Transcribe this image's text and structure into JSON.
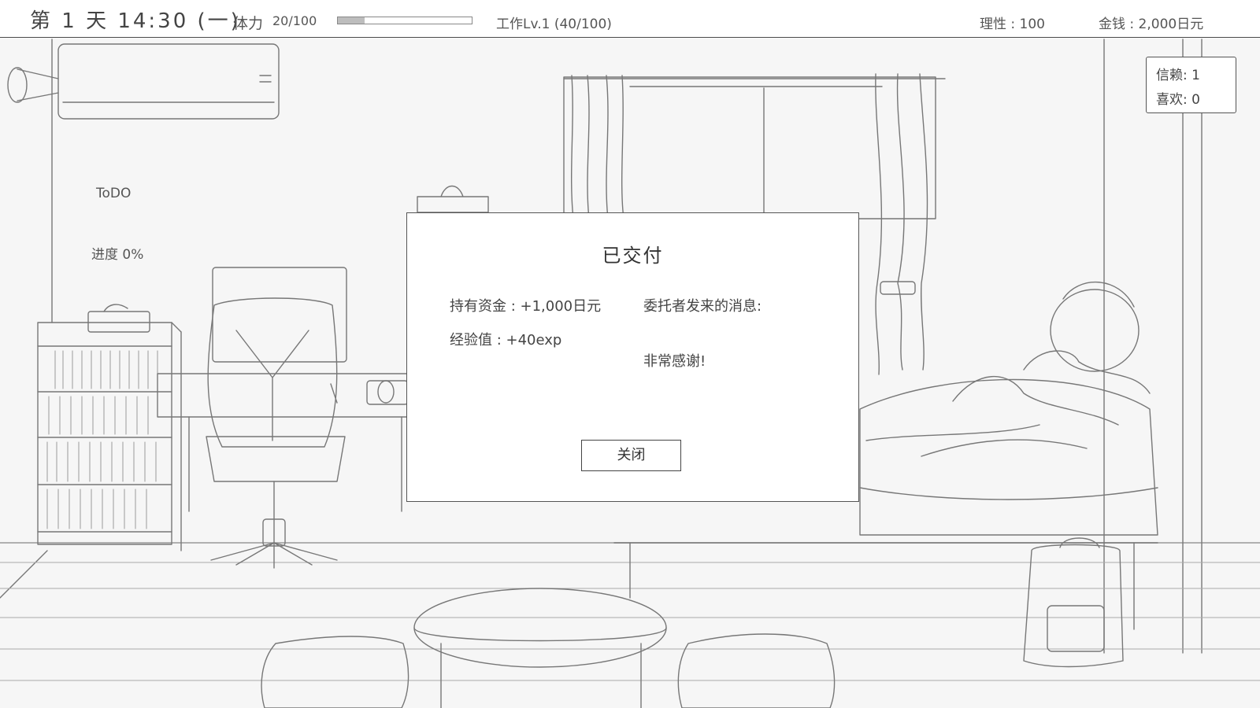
{
  "hud": {
    "day": "第 1 天 14:30 (一)",
    "stamina_label": "体力",
    "stamina_value": "20/100",
    "stamina_fraction": 0.2,
    "work": "工作Lv.1 (40/100)",
    "sanity": "理性 : 100",
    "money": "金钱 : 2,000日元"
  },
  "relationship": {
    "trust": "信赖: 1",
    "like": "喜欢: 0"
  },
  "todo": {
    "title": "ToDO",
    "progress": "进度 0%"
  },
  "dialog": {
    "title": "已交付",
    "funds": "持有资金 : +1,000日元",
    "exp": "经验值 : +40exp",
    "message_label": "委托者发来的消息:",
    "message": "非常感谢!",
    "close_label": "关闭"
  },
  "colors": {
    "line": "#4a4a4a",
    "paper": "#f6f6f6",
    "stamina_fill": "#bdbdbd"
  }
}
